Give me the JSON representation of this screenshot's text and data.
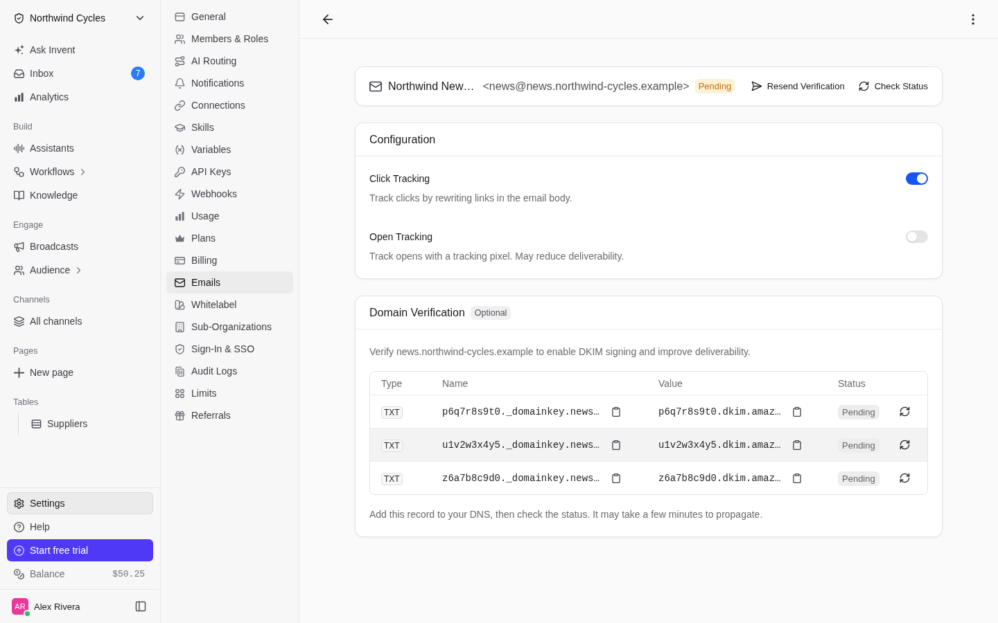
{
  "sidebar": {
    "workspace": "Northwind Cycles",
    "items": [
      {
        "label": "Ask Invent",
        "selected": false
      },
      {
        "label": "Inbox",
        "badge": "7",
        "selected": false
      },
      {
        "label": "Analytics",
        "selected": false
      }
    ],
    "sections": [
      {
        "title": "Build",
        "items": [
          {
            "label": "Assistants",
            "selected": false
          },
          {
            "label": "Workflows",
            "expanded": false,
            "selected": false
          },
          {
            "label": "Knowledge",
            "selected": false
          }
        ]
      },
      {
        "title": "Engage",
        "items": [
          {
            "label": "Broadcasts",
            "selected": false
          },
          {
            "label": "Audience",
            "expanded": false,
            "selected": false
          }
        ]
      },
      {
        "title": "Channels",
        "items": [
          {
            "label": "All channels",
            "selected": false
          }
        ]
      },
      {
        "title": "Pages",
        "items": [
          {
            "label": "New page",
            "selected": false
          }
        ]
      },
      {
        "title": "Tables",
        "children": [
          {
            "label": "Suppliers",
            "selected": false
          }
        ]
      }
    ],
    "footer_items": [
      {
        "label": "Settings",
        "selected": true
      },
      {
        "label": "Help",
        "selected": false
      }
    ],
    "trial_button": "Start free trial",
    "balance": {
      "label": "Balance",
      "value": "$50.25"
    },
    "user": {
      "initials": "AR",
      "name": "Alex Rivera",
      "online": true
    }
  },
  "settings_nav": {
    "items": [
      {
        "label": "General",
        "selected": false
      },
      {
        "label": "Members & Roles",
        "selected": false
      },
      {
        "label": "AI Routing",
        "selected": false
      },
      {
        "label": "Notifications",
        "selected": false
      },
      {
        "label": "Connections",
        "selected": false
      },
      {
        "label": "Skills",
        "selected": false
      },
      {
        "label": "Variables",
        "selected": false
      },
      {
        "label": "API Keys",
        "selected": false
      },
      {
        "label": "Webhooks",
        "selected": false
      },
      {
        "label": "Usage",
        "selected": false
      },
      {
        "label": "Plans",
        "selected": false
      },
      {
        "label": "Billing",
        "selected": false
      },
      {
        "label": "Emails",
        "selected": true
      },
      {
        "label": "Whitelabel",
        "selected": false
      },
      {
        "label": "Sub-Organizations",
        "selected": false
      },
      {
        "label": "Sign-In & SSO",
        "selected": false
      },
      {
        "label": "Audit Logs",
        "selected": false
      },
      {
        "label": "Limits",
        "selected": false
      },
      {
        "label": "Referrals",
        "selected": false
      }
    ]
  },
  "sender": {
    "name": "Northwind New…",
    "address": "<news@news.northwind-cycles.example>",
    "status": "Pending",
    "actions": [
      "Resend Verification",
      "Check Status"
    ]
  },
  "configuration": {
    "title": "Configuration",
    "settings": [
      {
        "label": "Click Tracking",
        "description": "Track clicks by rewriting links in the email body.",
        "on": true
      },
      {
        "label": "Open Tracking",
        "description": "Track opens with a tracking pixel. May reduce deliverability.",
        "on": false
      }
    ]
  },
  "domain_verification": {
    "title": "Domain Verification",
    "badge": "Optional",
    "description": "Verify news.northwind-cycles.example to enable DKIM signing and improve deliverability.",
    "table": {
      "columns": [
        "Type",
        "Name",
        "Value",
        "Status"
      ],
      "rows": [
        {
          "type": "TXT",
          "name": "p6q7r8s9t0._domainkey.news…",
          "value": "p6q7r8s9t0.dkim.amaz…",
          "status": "Pending",
          "highlighted": false
        },
        {
          "type": "TXT",
          "name": "u1v2w3x4y5._domainkey.news…",
          "value": "u1v2w3x4y5.dkim.amaz…",
          "status": "Pending",
          "highlighted": true
        },
        {
          "type": "TXT",
          "name": "z6a7b8c9d0._domainkey.news…",
          "value": "z6a7b8c9d0.dkim.amaz…",
          "status": "Pending",
          "highlighted": false
        }
      ]
    },
    "note": "Add this record to your DNS, then check the status. It may take a few minutes to propagate."
  }
}
